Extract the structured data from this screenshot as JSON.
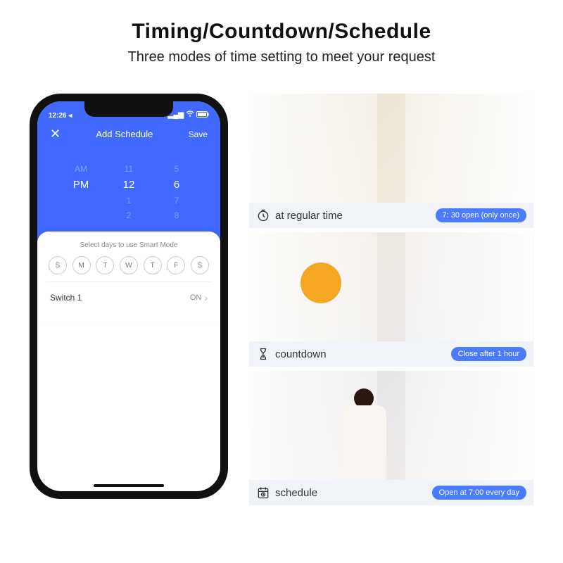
{
  "header": {
    "title": "Timing/Countdown/Schedule",
    "subtitle": "Three modes of time setting to meet your request"
  },
  "phone": {
    "status_time": "12:26",
    "app_close": "✕",
    "app_title": "Add Schedule",
    "app_save": "Save",
    "picker": {
      "col1": {
        "above": "AM",
        "sel": "PM",
        "below": ""
      },
      "col2": {
        "above": "11",
        "sel": "12",
        "below1": "1",
        "below2": "2"
      },
      "col3": {
        "above": "5",
        "sel": "6",
        "below1": "7",
        "below2": "8"
      }
    },
    "card_label": "Select days to use Smart Mode",
    "days": [
      "S",
      "M",
      "T",
      "W",
      "T",
      "F",
      "S"
    ],
    "switch_label": "Switch 1",
    "switch_value": "ON"
  },
  "tiles": [
    {
      "label": "at regular time",
      "badge": "7: 30 open (only once)"
    },
    {
      "label": "countdown",
      "badge": "Close after 1 hour"
    },
    {
      "label": "schedule",
      "badge": "Open at 7:00 every day"
    }
  ]
}
